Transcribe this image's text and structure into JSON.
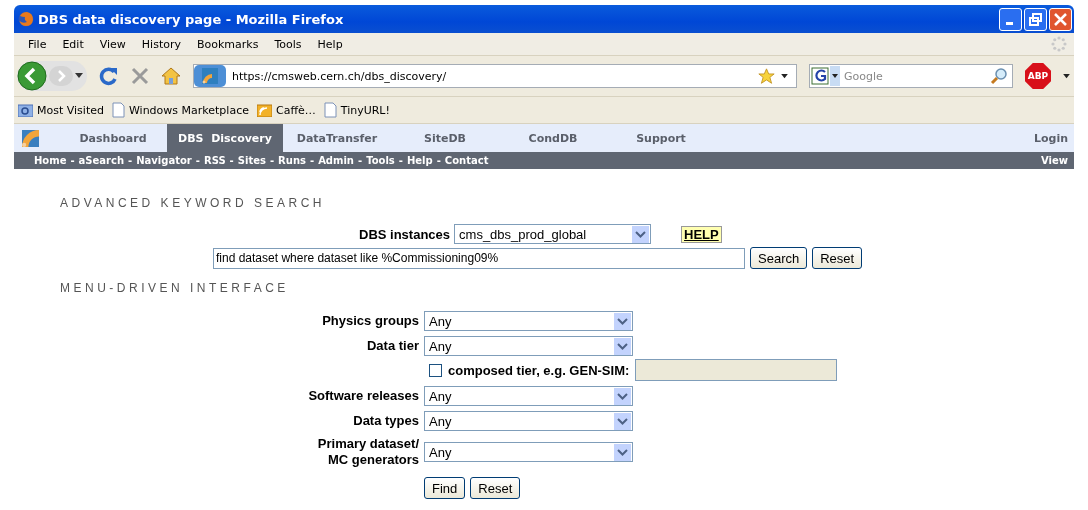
{
  "window": {
    "title": "DBS data discovery page - Mozilla Firefox"
  },
  "menu": [
    "File",
    "Edit",
    "View",
    "History",
    "Bookmarks",
    "Tools",
    "Help"
  ],
  "toolbar": {
    "url": "https://cmsweb.cern.ch/dbs_discovery/",
    "search_placeholder": "Google",
    "adblock": "ABP"
  },
  "bookmarks": [
    {
      "label": "Most Visited",
      "kind": "folder"
    },
    {
      "label": "Windows Marketplace",
      "kind": "page"
    },
    {
      "label": "Caffè…",
      "kind": "feed"
    },
    {
      "label": "TinyURL!",
      "kind": "page"
    }
  ],
  "site_tabs": [
    {
      "label": "Dashboard",
      "selected": false
    },
    {
      "label": "DBS  Discovery",
      "selected": true
    },
    {
      "label": "DataTransfer",
      "selected": false
    },
    {
      "label": "SiteDB",
      "selected": false
    },
    {
      "label": "CondDB",
      "selected": false
    },
    {
      "label": "Support",
      "selected": false
    }
  ],
  "login": "Login",
  "subnav": {
    "links": [
      "Home",
      "aSearch",
      "Navigator",
      "RSS",
      "Sites",
      "Runs",
      "Admin",
      "Tools",
      "Help",
      "Contact"
    ],
    "separator": "-",
    "right": "View"
  },
  "keyword_search": {
    "heading": "ADVANCED KEYWORD SEARCH",
    "instances_label": "DBS instances",
    "instance": "cms_dbs_prod_global",
    "help": "HELP",
    "query": "find dataset where dataset like %Commissioning09%",
    "search_button": "Search",
    "reset_button": "Reset"
  },
  "menu_driven": {
    "heading": "MENU-DRIVEN INTERFACE",
    "fields": [
      {
        "kind": "select",
        "label": "Physics groups",
        "value": "Any"
      },
      {
        "kind": "select",
        "label": "Data tier",
        "value": "Any"
      },
      {
        "kind": "checkbox",
        "label": "composed tier, e.g. GEN-SIM:",
        "checked": false
      },
      {
        "kind": "select",
        "label": "Software releases",
        "value": "Any"
      },
      {
        "kind": "select",
        "label": "Data types",
        "value": "Any"
      },
      {
        "kind": "select",
        "label": "Primary dataset/\nMC generators",
        "value": "Any"
      }
    ],
    "buttons": [
      "Find",
      "Reset"
    ]
  }
}
